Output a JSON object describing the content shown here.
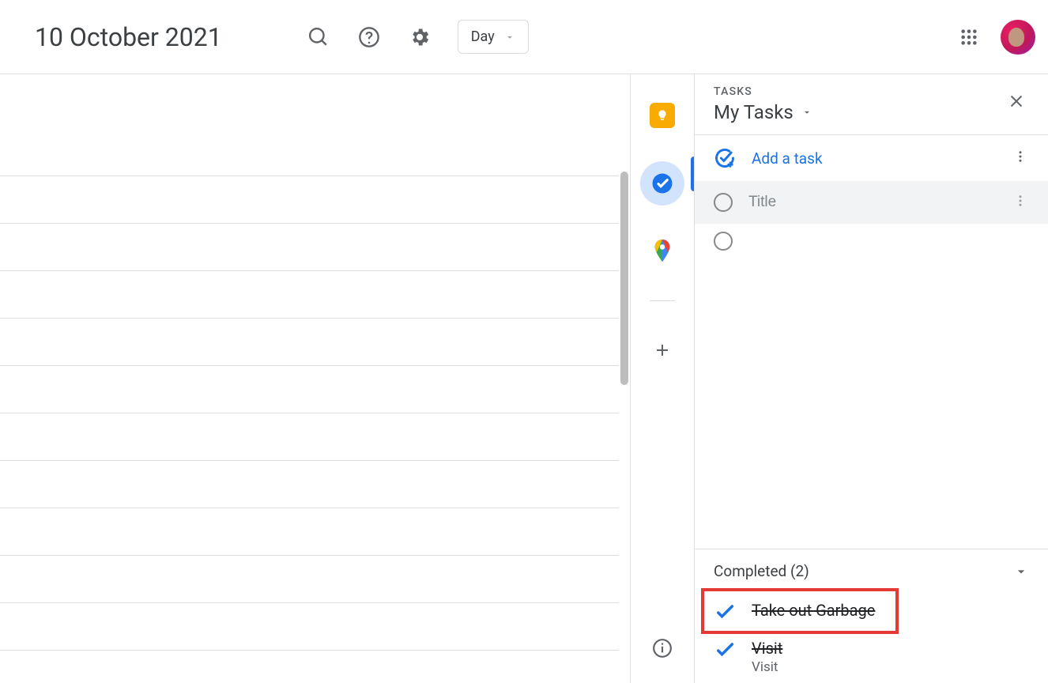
{
  "header": {
    "date": "10 October 2021",
    "view_label": "Day"
  },
  "rail": {
    "keep": "keep",
    "tasks": "tasks",
    "maps": "maps",
    "addons": "addons",
    "info": "info"
  },
  "tasks": {
    "panel_label": "TASKS",
    "list_title": "My Tasks",
    "add_label": "Add a task",
    "new_task_placeholder": "Title",
    "completed_header": "Completed (2)",
    "completed": [
      {
        "title": "Take out Garbage",
        "sub": ""
      },
      {
        "title": "Visit",
        "sub": "Visit"
      }
    ]
  }
}
